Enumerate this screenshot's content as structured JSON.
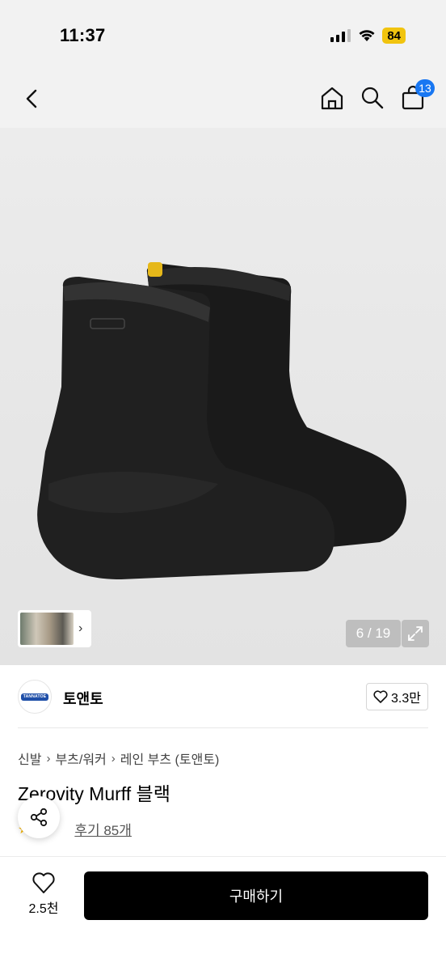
{
  "status": {
    "time": "11:37",
    "battery": "84"
  },
  "nav": {
    "cart_count": "13"
  },
  "gallery": {
    "counter": "6 / 19",
    "thumb_arrow": "›"
  },
  "brand": {
    "logo_text": "TANNATOE",
    "name": "토앤토",
    "likes": "3.3만"
  },
  "breadcrumb": [
    "신발",
    "부츠/워커",
    "레인 부츠 (토앤토)"
  ],
  "product": {
    "title": "Zerovity Murff 블랙",
    "review_link": "후기 85개"
  },
  "bottom": {
    "wish_count": "2.5천",
    "buy_label": "구매하기"
  },
  "colors": {
    "accent_blue": "#1877f2",
    "battery_yellow": "#f1c40f",
    "buy_button": "#000000"
  },
  "icons": [
    "back-chevron-icon",
    "home-icon",
    "search-icon",
    "cart-icon",
    "expand-icon",
    "heart-icon",
    "share-icon",
    "star-icon"
  ]
}
